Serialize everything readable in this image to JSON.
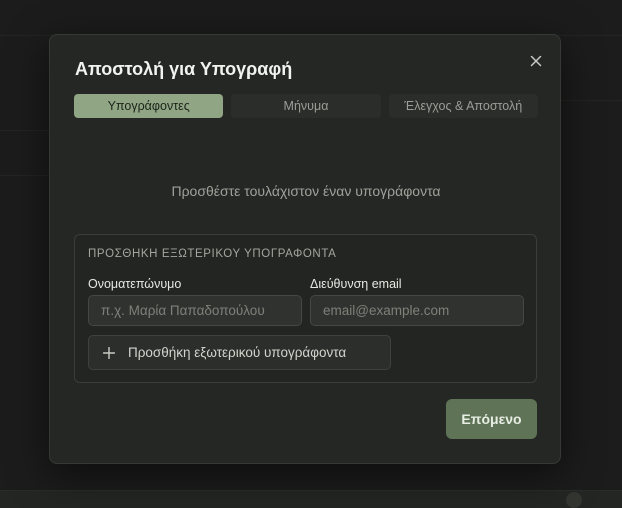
{
  "dialog": {
    "title": "Αποστολή για Υπογραφή",
    "close_icon": "close-icon"
  },
  "tabs": [
    {
      "label": "Υπογράφοντες",
      "active": true
    },
    {
      "label": "Μήνυμα",
      "active": false
    },
    {
      "label": "Έλεγχος & Αποστολή",
      "active": false
    }
  ],
  "empty_message": "Προσθέστε τουλάχιστον έναν υπογράφοντα",
  "external_signer": {
    "heading": "ΠΡΟΣΘΗΚΗ ΕΞΩΤΕΡΙΚΟΥ ΥΠΟΓΡΑΦΟΝΤΑ",
    "name_label": "Ονοματεπώνυμο",
    "name_placeholder": "π.χ. Μαρία Παπαδοπούλου",
    "name_value": "",
    "email_label": "Διεύθυνση email",
    "email_placeholder": "email@example.com",
    "email_value": "",
    "add_label": "Προσθήκη εξωτερικού υπογράφοντα",
    "add_icon": "plus-icon"
  },
  "footer": {
    "next_label": "Επόμενο"
  },
  "colors": {
    "accent": "#8fa584",
    "primary_button": "#5f7457",
    "dialog_bg": "#252724"
  }
}
